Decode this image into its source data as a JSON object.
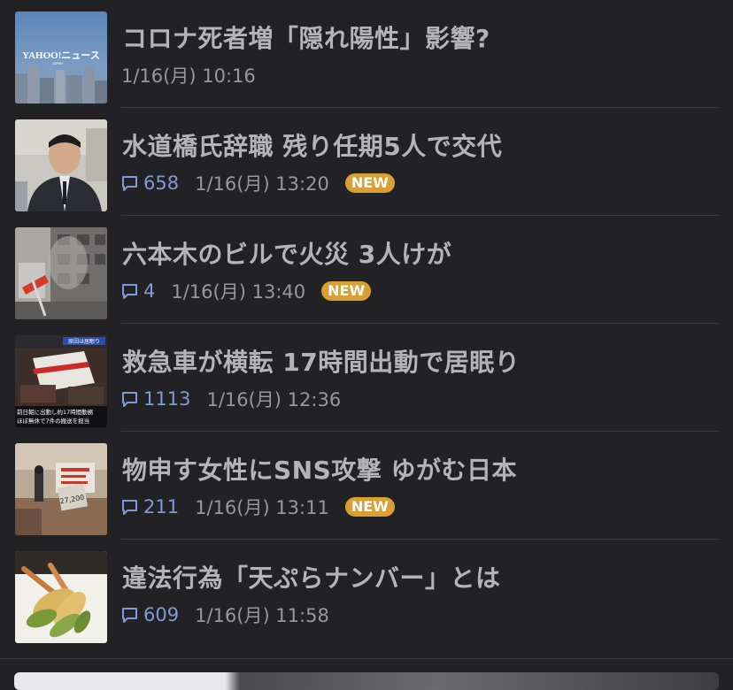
{
  "news": {
    "items": [
      {
        "title": "コロナ死者増「隠れ陽性」影響?",
        "comments": "",
        "timestamp": "1/16(月) 10:16",
        "badge": "",
        "thumb_text": "YAHOO!ニュース",
        "thumb_subtext": "JAPAN"
      },
      {
        "title": "水道橋氏辞職 残り任期5人で交代",
        "comments": "658",
        "timestamp": "1/16(月) 13:20",
        "badge": "NEW"
      },
      {
        "title": "六本木のビルで火災 3人けが",
        "comments": "4",
        "timestamp": "1/16(月) 13:40",
        "badge": "NEW"
      },
      {
        "title": "救急車が横転 17時間出動で居眠り",
        "comments": "1113",
        "timestamp": "1/16(月) 12:36",
        "badge": "",
        "thumb_caption_top": "原因は居眠り",
        "thumb_caption_1": "前日朝に出動し約17時間勤務",
        "thumb_caption_2": "ほぼ無休で7件の搬送を担当"
      },
      {
        "title": "物申す女性にSNS攻撃 ゆがむ日本",
        "comments": "211",
        "timestamp": "1/16(月) 13:11",
        "badge": "NEW",
        "thumb_sign": "27,200"
      },
      {
        "title": "違法行為「天ぷらナンバー」とは",
        "comments": "609",
        "timestamp": "1/16(月) 11:58",
        "badge": ""
      }
    ]
  },
  "colors": {
    "background": "#222224",
    "title_text": "#b4b4b8",
    "meta_text": "#98989c",
    "comment_accent": "#7f9bd6",
    "badge_bg": "#d8a033",
    "divider": "#3a3a3e"
  },
  "icons": {
    "comment": "comment-bubble-icon"
  }
}
